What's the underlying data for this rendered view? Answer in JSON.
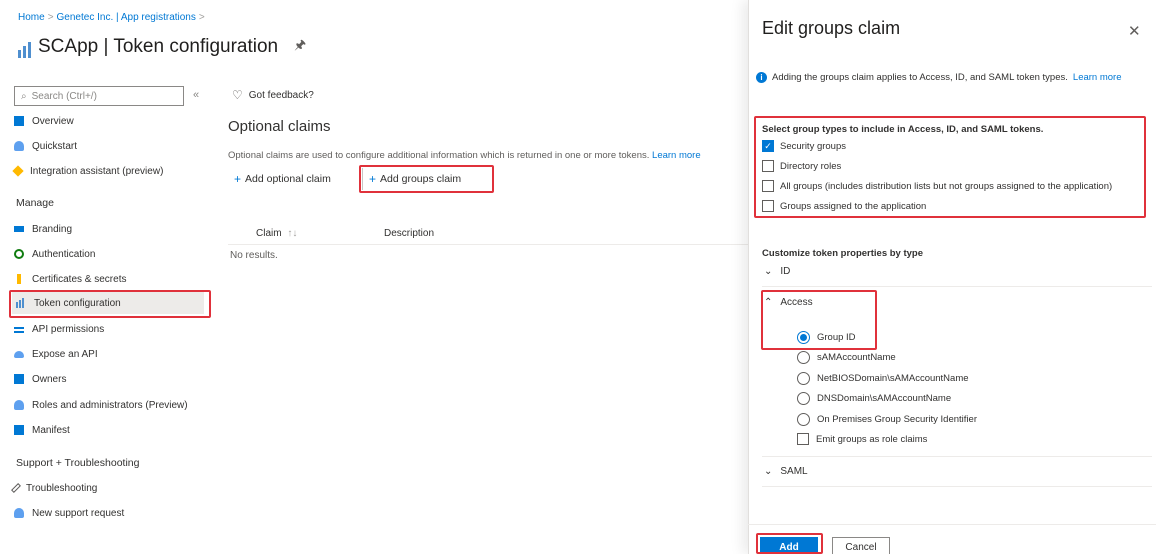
{
  "breadcrumb": [
    "Home",
    "Genetec Inc. | App registrations"
  ],
  "title": "SCApp | Token configuration",
  "sidebar": {
    "search_placeholder": "Search (Ctrl+/)",
    "top_items": [
      {
        "label": "Overview",
        "icon": "grid-icon",
        "color": "#0078d4"
      },
      {
        "label": "Quickstart",
        "icon": "cloud-icon",
        "color": "#0078d4"
      },
      {
        "label": "Integration assistant (preview)",
        "icon": "rocket-icon",
        "color": "#ffb900"
      }
    ],
    "manage_header": "Manage",
    "manage_items": [
      {
        "label": "Branding",
        "icon": "branding-icon",
        "color": "#0078d4"
      },
      {
        "label": "Authentication",
        "icon": "refresh-icon",
        "color": "#107c10"
      },
      {
        "label": "Certificates & secrets",
        "icon": "key-icon",
        "color": "#ffb900"
      },
      {
        "label": "Token configuration",
        "icon": "token-icon",
        "color": "#0078d4"
      },
      {
        "label": "API permissions",
        "icon": "api-icon",
        "color": "#0078d4"
      },
      {
        "label": "Expose an API",
        "icon": "cloud-icon",
        "color": "#0078d4"
      },
      {
        "label": "Owners",
        "icon": "grid-icon",
        "color": "#0078d4"
      },
      {
        "label": "Roles and administrators (Preview)",
        "icon": "person-icon",
        "color": "#0078d4"
      },
      {
        "label": "Manifest",
        "icon": "manifest-icon",
        "color": "#0078d4"
      }
    ],
    "support_header": "Support + Troubleshooting",
    "support_items": [
      {
        "label": "Troubleshooting",
        "icon": "wrench-icon",
        "color": "#605e5c"
      },
      {
        "label": "New support request",
        "icon": "person-icon",
        "color": "#0078d4"
      }
    ]
  },
  "main": {
    "feedback": "Got feedback?",
    "heading": "Optional claims",
    "description": "Optional claims are used to configure additional information which is returned in one or more tokens.",
    "learn_more": "Learn more",
    "add_optional": "Add optional claim",
    "add_groups": "Add groups claim",
    "col_claim": "Claim",
    "col_description": "Description",
    "no_results": "No results."
  },
  "panel": {
    "title": "Edit groups claim",
    "info": "Adding the groups claim applies to Access, ID, and SAML token types.",
    "info_link": "Learn more",
    "group_types_header": "Select group types to include in Access, ID, and SAML tokens.",
    "group_types": [
      {
        "label": "Security groups",
        "checked": true
      },
      {
        "label": "Directory roles",
        "checked": false
      },
      {
        "label": "All groups (includes distribution lists but not groups assigned to the application)",
        "checked": false
      },
      {
        "label": "Groups assigned to the application",
        "checked": false
      }
    ],
    "customize_header": "Customize token properties by type",
    "id_label": "ID",
    "access_label": "Access",
    "saml_label": "SAML",
    "access_options": [
      {
        "label": "Group ID",
        "selected": true
      },
      {
        "label": "sAMAccountName",
        "selected": false
      },
      {
        "label": "NetBIOSDomain\\sAMAccountName",
        "selected": false
      },
      {
        "label": "DNSDomain\\sAMAccountName",
        "selected": false
      },
      {
        "label": "On Premises Group Security Identifier",
        "selected": false
      }
    ],
    "emit_roles": "Emit groups as role claims",
    "add": "Add",
    "cancel": "Cancel"
  }
}
